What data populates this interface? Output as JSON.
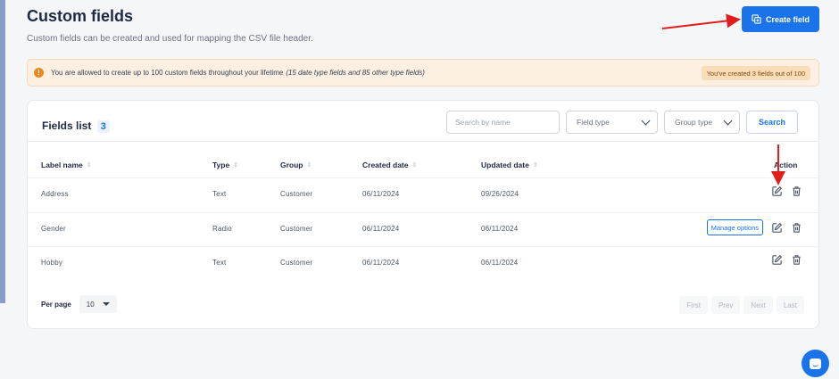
{
  "header": {
    "title": "Custom fields",
    "subtitle": "Custom fields can be created and used for mapping the CSV file header.",
    "create_button": "Create field"
  },
  "notice": {
    "icon": "exclamation-icon",
    "text": "You are allowed to create up to 100 custom fields throughout your lifetime",
    "detail": "(15 date type fields and 85 other type fields)",
    "badge": "You've created 3 fields out of 100"
  },
  "fields_list": {
    "title": "Fields list",
    "count": "3",
    "search_placeholder": "Search by name",
    "field_type_label": "Field type",
    "group_type_label": "Group type",
    "search_button": "Search"
  },
  "table": {
    "columns": {
      "label": "Label name",
      "type": "Type",
      "group": "Group",
      "created": "Created date",
      "updated": "Updated date",
      "action": "Action"
    },
    "rows": [
      {
        "label": "Address",
        "type": "Text",
        "group": "Customer",
        "created": "06/11/2024",
        "updated": "09/26/2024",
        "manage": ""
      },
      {
        "label": "Gender",
        "type": "Radio",
        "group": "Customer",
        "created": "06/11/2024",
        "updated": "06/11/2024",
        "manage": "Manage options"
      },
      {
        "label": "Hobby",
        "type": "Text",
        "group": "Customer",
        "created": "06/11/2024",
        "updated": "06/11/2024",
        "manage": ""
      }
    ]
  },
  "pagination": {
    "per_page_label": "Per page",
    "per_page_value": "10",
    "first": "First",
    "prev": "Prev",
    "next": "Next",
    "last": "Last"
  },
  "colors": {
    "accent": "#1a73e8",
    "annotation_arrow": "#e11d1d",
    "notice_bg": "#fdf0e3"
  }
}
